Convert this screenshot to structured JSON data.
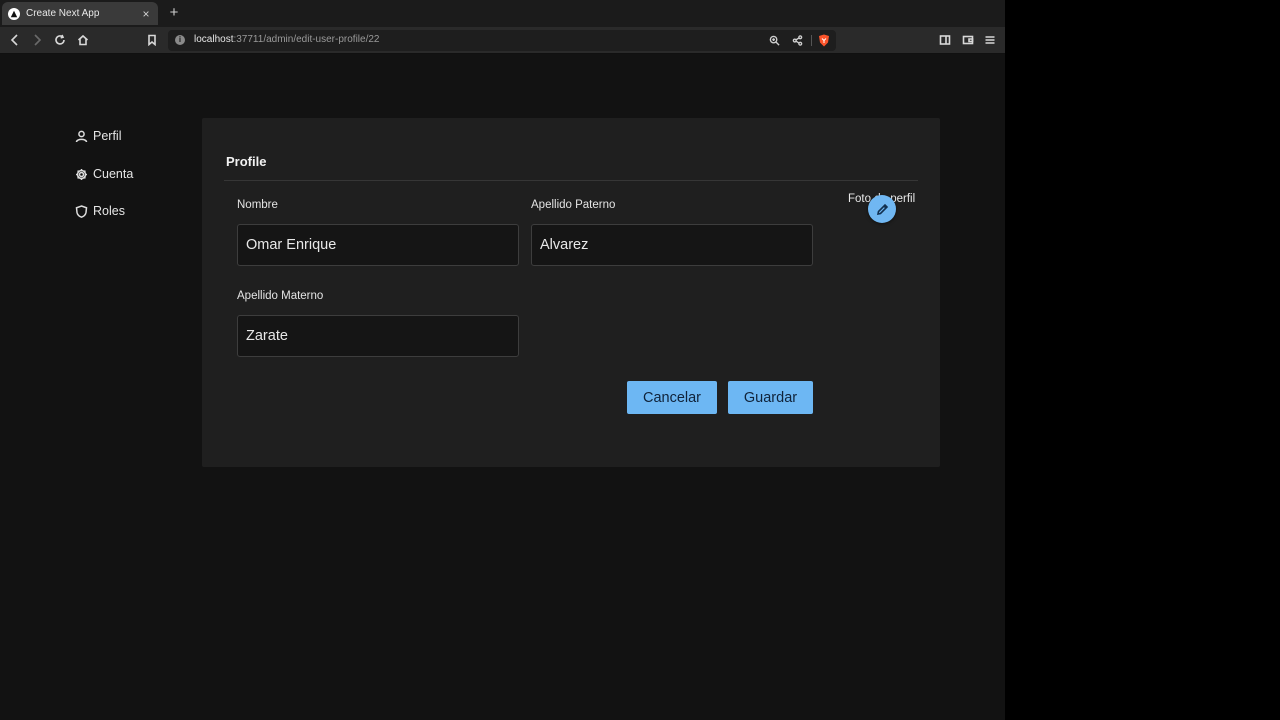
{
  "browser": {
    "tab_title": "Create Next App",
    "tab_close": "×",
    "new_tab": "+",
    "url_host": "localhost",
    "url_rest": ":37711/admin/edit-user-profile/22",
    "url_info": "i"
  },
  "sidebar": {
    "items": [
      {
        "label": "Perfil",
        "icon": "user-icon"
      },
      {
        "label": "Cuenta",
        "icon": "gear-icon"
      },
      {
        "label": "Roles",
        "icon": "shield-icon"
      }
    ]
  },
  "profile": {
    "title": "Profile",
    "photo_label": "Foto de perfil",
    "fields": {
      "nombre": {
        "label": "Nombre",
        "value": "Omar Enrique"
      },
      "apellido_paterno": {
        "label": "Apellido Paterno",
        "value": "Alvarez"
      },
      "apellido_materno": {
        "label": "Apellido Materno",
        "value": "Zarate"
      }
    },
    "cancel_label": "Cancelar",
    "save_label": "Guardar"
  },
  "colors": {
    "accent": "#6db7f3",
    "page_bg": "#121212",
    "card_bg": "#1f1f1f"
  }
}
